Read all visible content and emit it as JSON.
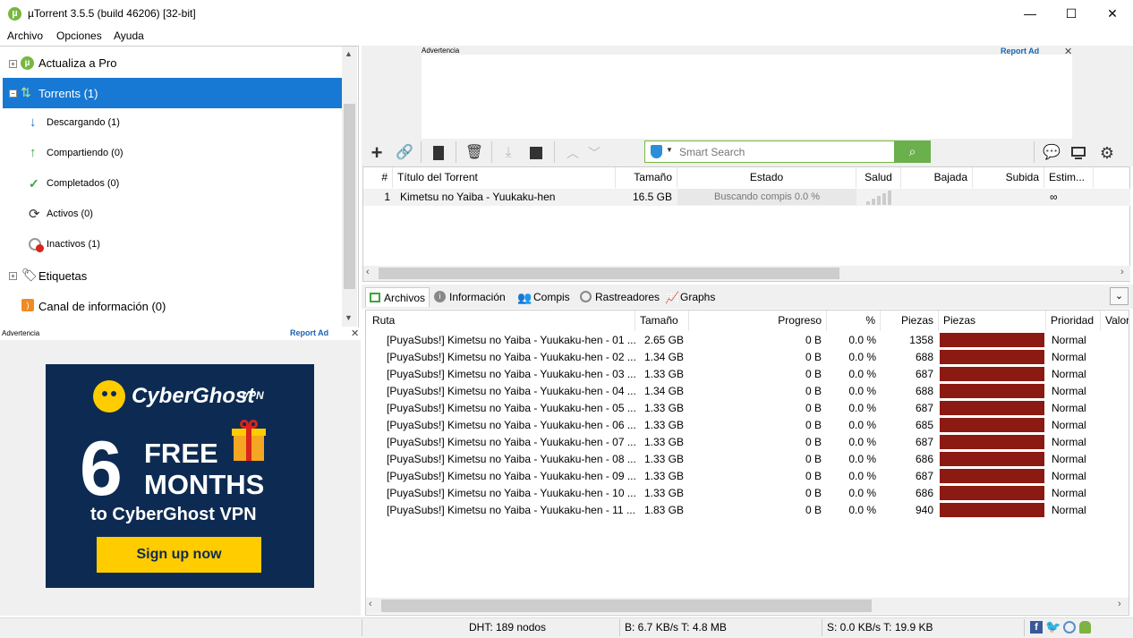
{
  "window": {
    "title": "µTorrent 3.5.5  (build 46206) [32-bit]"
  },
  "menu": [
    "Archivo",
    "Opciones",
    "Ayuda"
  ],
  "sidebar": {
    "items": [
      {
        "label": "Actualiza a Pro"
      },
      {
        "label": "Torrents (1)"
      },
      {
        "label": "Descargando (1)"
      },
      {
        "label": "Compartiendo (0)"
      },
      {
        "label": "Completados (0)"
      },
      {
        "label": "Activos (0)"
      },
      {
        "label": "Inactivos (1)"
      },
      {
        "label": "Etiquetas"
      },
      {
        "label": "Canal de información (0)"
      }
    ]
  },
  "ads": {
    "label": "Advertencia",
    "report": "Report Ad",
    "brand": "CyberGhost",
    "brand_suffix": "VPN",
    "big_number": "6",
    "line1": "FREE",
    "line2": "MONTHS",
    "line3": "to CyberGhost VPN",
    "cta": "Sign up now"
  },
  "search": {
    "placeholder": "Smart Search"
  },
  "torrent_list": {
    "columns": [
      "#",
      "Título del Torrent",
      "Tamaño",
      "Estado",
      "Salud",
      "Bajada",
      "Subida",
      "Estim..."
    ],
    "rows": [
      {
        "num": "1",
        "name": "Kimetsu no Yaiba - Yuukaku-hen",
        "size": "16.5 GB",
        "status": "Buscando compis 0.0 %",
        "eta": "∞"
      }
    ]
  },
  "tabs": [
    "Archivos",
    "Información",
    "Compis",
    "Rastreadores",
    "Graphs"
  ],
  "files": {
    "columns": [
      "Ruta",
      "Tamaño",
      "Progreso",
      "%",
      "Piezas",
      "Piezas",
      "Prioridad",
      "Valor"
    ],
    "rows": [
      {
        "path": "[PuyaSubs!] Kimetsu no Yaiba - Yuukaku-hen - 01 ...",
        "size": "2.65 GB",
        "done": "0 B",
        "pct": "0.0 %",
        "pieces": "1358",
        "priority": "Normal"
      },
      {
        "path": "[PuyaSubs!] Kimetsu no Yaiba - Yuukaku-hen - 02 ...",
        "size": "1.34 GB",
        "done": "0 B",
        "pct": "0.0 %",
        "pieces": "688",
        "priority": "Normal"
      },
      {
        "path": "[PuyaSubs!] Kimetsu no Yaiba - Yuukaku-hen - 03 ...",
        "size": "1.33 GB",
        "done": "0 B",
        "pct": "0.0 %",
        "pieces": "687",
        "priority": "Normal"
      },
      {
        "path": "[PuyaSubs!] Kimetsu no Yaiba - Yuukaku-hen - 04 ...",
        "size": "1.34 GB",
        "done": "0 B",
        "pct": "0.0 %",
        "pieces": "688",
        "priority": "Normal"
      },
      {
        "path": "[PuyaSubs!] Kimetsu no Yaiba - Yuukaku-hen - 05 ...",
        "size": "1.33 GB",
        "done": "0 B",
        "pct": "0.0 %",
        "pieces": "687",
        "priority": "Normal"
      },
      {
        "path": "[PuyaSubs!] Kimetsu no Yaiba - Yuukaku-hen - 06 ...",
        "size": "1.33 GB",
        "done": "0 B",
        "pct": "0.0 %",
        "pieces": "685",
        "priority": "Normal"
      },
      {
        "path": "[PuyaSubs!] Kimetsu no Yaiba - Yuukaku-hen - 07 ...",
        "size": "1.33 GB",
        "done": "0 B",
        "pct": "0.0 %",
        "pieces": "687",
        "priority": "Normal"
      },
      {
        "path": "[PuyaSubs!] Kimetsu no Yaiba - Yuukaku-hen - 08 ...",
        "size": "1.33 GB",
        "done": "0 B",
        "pct": "0.0 %",
        "pieces": "686",
        "priority": "Normal"
      },
      {
        "path": "[PuyaSubs!] Kimetsu no Yaiba - Yuukaku-hen - 09 ...",
        "size": "1.33 GB",
        "done": "0 B",
        "pct": "0.0 %",
        "pieces": "687",
        "priority": "Normal"
      },
      {
        "path": "[PuyaSubs!] Kimetsu no Yaiba - Yuukaku-hen - 10 ...",
        "size": "1.33 GB",
        "done": "0 B",
        "pct": "0.0 %",
        "pieces": "686",
        "priority": "Normal"
      },
      {
        "path": "[PuyaSubs!] Kimetsu no Yaiba - Yuukaku-hen - 11 ...",
        "size": "1.83 GB",
        "done": "0 B",
        "pct": "0.0 %",
        "pieces": "940",
        "priority": "Normal"
      }
    ]
  },
  "status": {
    "dht": "DHT: 189 nodos",
    "down": "B: 6.7 KB/s T: 4.8 MB",
    "up": "S: 0.0 KB/s T: 19.9 KB"
  },
  "colors": {
    "selection": "#1879d4",
    "piece_bar": "#8b1a12",
    "search_accent": "#6ab04c",
    "ad_cta": "#ffcc00"
  }
}
